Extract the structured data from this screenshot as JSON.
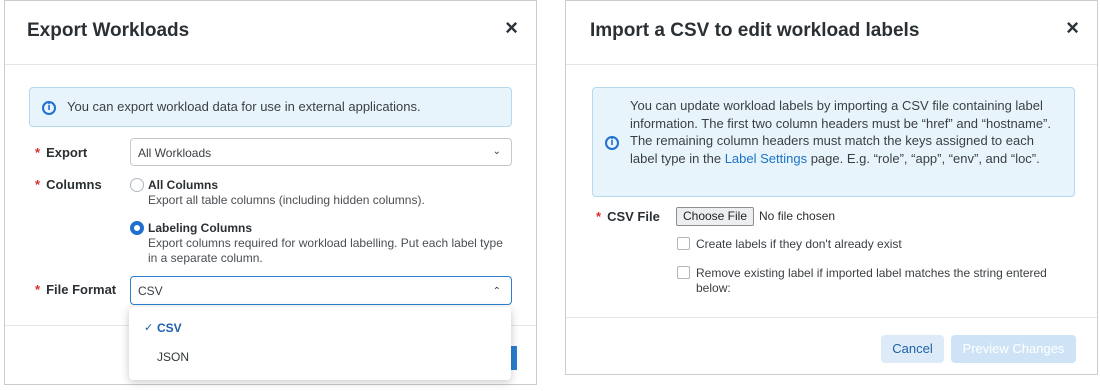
{
  "export_dialog": {
    "title": "Export Workloads",
    "close_glyph": "×",
    "info_icon": "info-icon",
    "info_text": "You can export workload data for use in external applications.",
    "required_mark": "*",
    "export_label": "Export",
    "export_value": "All Workloads",
    "columns_label": "Columns",
    "columns_options": [
      {
        "title": "All Columns",
        "desc": "Export all table columns (including hidden columns).",
        "checked": false
      },
      {
        "title": "Labeling Columns",
        "desc": "Export columns required for workload labelling. Put each label type in a separate column.",
        "checked": true
      }
    ],
    "file_format_label": "File Format",
    "file_format_value": "CSV",
    "file_format_options": [
      {
        "label": "CSV",
        "selected": true
      },
      {
        "label": "JSON",
        "selected": false
      }
    ],
    "check_glyph": "✓",
    "chevron_down": "⌄",
    "chevron_up": "⌃"
  },
  "import_dialog": {
    "title": "Import a CSV to edit workload labels",
    "close_glyph": "×",
    "info_text_before_link": "You can update workload labels by importing a CSV file containing label information. The first two column headers must be “href” and “hostname”. The remaining column headers must match the keys assigned to each label type in the ",
    "info_link": "Label Settings",
    "info_text_after_link": " page. E.g. “role”, “app”, “env”, and “loc”.",
    "required_mark": "*",
    "csv_file_label": "CSV File",
    "choose_file_button": "Choose File",
    "file_status": "No file chosen",
    "checkboxes": [
      {
        "label": "Create labels if they don't already exist",
        "checked": false
      },
      {
        "label": "Remove existing label if imported label matches the string entered below:",
        "checked": false
      }
    ],
    "cancel_button": "Cancel",
    "preview_button": "Preview Changes"
  },
  "colors": {
    "primary": "#1f6fd0",
    "required": "#d62e2e",
    "info_bg": "#e8f4fb",
    "link": "#1b73c9"
  }
}
